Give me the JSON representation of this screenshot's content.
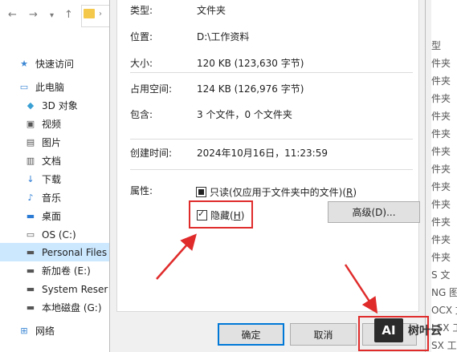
{
  "explorer": {
    "sidebar": [
      {
        "label": "快速访问",
        "icon": "star-icon"
      },
      {
        "label": "此电脑",
        "icon": "computer-icon"
      },
      {
        "label": "3D 对象",
        "icon": "cube-icon"
      },
      {
        "label": "视频",
        "icon": "video-icon"
      },
      {
        "label": "图片",
        "icon": "picture-icon"
      },
      {
        "label": "文档",
        "icon": "document-icon"
      },
      {
        "label": "下载",
        "icon": "download-icon"
      },
      {
        "label": "音乐",
        "icon": "music-icon"
      },
      {
        "label": "桌面",
        "icon": "desktop-icon"
      },
      {
        "label": "OS (C:)",
        "icon": "drive-os-icon"
      },
      {
        "label": "Personal Files",
        "icon": "drive-icon"
      },
      {
        "label": "新加卷 (E:)",
        "icon": "drive-icon"
      },
      {
        "label": "System Reser",
        "icon": "drive-icon"
      },
      {
        "label": "本地磁盘 (G:)",
        "icon": "drive-icon"
      },
      {
        "label": "网络",
        "icon": "network-icon"
      }
    ],
    "right_column": [
      "型",
      "件夹",
      "件夹",
      "件夹",
      "件夹",
      "件夹",
      "件夹",
      "件夹",
      "件夹",
      "件夹",
      "件夹",
      "件夹",
      "件夹",
      "S 文",
      "NG 图",
      "OCX 文",
      "LSX 工",
      "SX 工"
    ]
  },
  "dialog": {
    "props": [
      {
        "label": "类型:",
        "value": "文件夹"
      },
      {
        "label": "位置:",
        "value": "D:\\工作资料"
      },
      {
        "label": "大小:",
        "value": "120 KB (123,630 字节)"
      },
      {
        "label": "占用空间:",
        "value": "124 KB (126,976 字节)"
      },
      {
        "label": "包含:",
        "value": "3 个文件，0 个文件夹"
      },
      {
        "label": "创建时间:",
        "value": "2024年10月16日，11:23:59"
      }
    ],
    "attributes_label": "属性:",
    "readonly": {
      "text": "只读(仅应用于文件夹中的文件)(",
      "key": "R",
      "end": ")"
    },
    "hidden": {
      "text": "隐藏(",
      "key": "H",
      "end": ")"
    },
    "advanced_label": "高级(D)...",
    "ok_label": "确定",
    "cancel_label": "取消"
  },
  "watermark": {
    "logo": "AI",
    "text": "树叶云"
  },
  "colors": {
    "highlight": "#e02b2b",
    "selected": "#cce8ff",
    "accent": "#0078d7"
  }
}
